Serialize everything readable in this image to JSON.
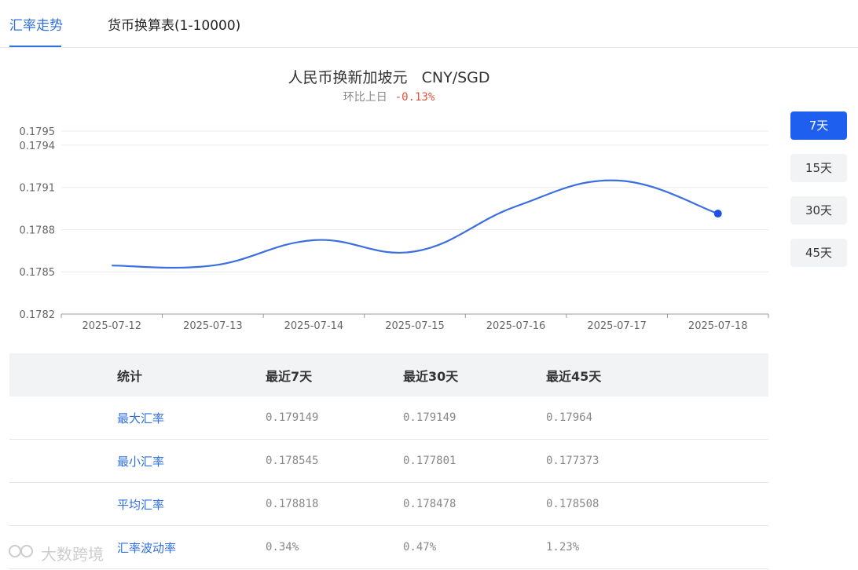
{
  "tabs": [
    {
      "label": "汇率走势",
      "active": true
    },
    {
      "label": "货币换算表(1-10000)",
      "active": false
    }
  ],
  "chart_header": {
    "title": "人民币换新加坡元   CNY/SGD",
    "change_label": "环比上日",
    "change_value": "-0.13%"
  },
  "periods": [
    {
      "label": "7天",
      "active": true
    },
    {
      "label": "15天",
      "active": false
    },
    {
      "label": "30天",
      "active": false
    },
    {
      "label": "45天",
      "active": false
    }
  ],
  "chart_data": {
    "type": "line",
    "title": "人民币换新加坡元   CNY/SGD",
    "x": [
      "2025-07-12",
      "2025-07-13",
      "2025-07-14",
      "2025-07-15",
      "2025-07-16",
      "2025-07-17",
      "2025-07-18"
    ],
    "series": [
      {
        "values": [
          0.178545,
          0.178545,
          0.178725,
          0.178645,
          0.178965,
          0.179149,
          0.178914
        ]
      }
    ],
    "y_ticks": [
      0.1782,
      0.1785,
      0.1788,
      0.1791,
      0.1794,
      0.1795
    ],
    "ylim": [
      0.1782,
      0.1795
    ],
    "grid": true,
    "line_color": "#3b6fe0"
  },
  "stats": {
    "headers": [
      "统计",
      "最近7天",
      "最近30天",
      "最近45天"
    ],
    "rows": [
      {
        "label": "最大汇率",
        "values": [
          "0.179149",
          "0.179149",
          "0.17964"
        ]
      },
      {
        "label": "最小汇率",
        "values": [
          "0.178545",
          "0.177801",
          "0.177373"
        ]
      },
      {
        "label": "平均汇率",
        "values": [
          "0.178818",
          "0.178478",
          "0.178508"
        ]
      },
      {
        "label": "汇率波动率",
        "values": [
          "0.34%",
          "0.47%",
          "1.23%"
        ]
      }
    ]
  },
  "watermark": "大数跨境"
}
